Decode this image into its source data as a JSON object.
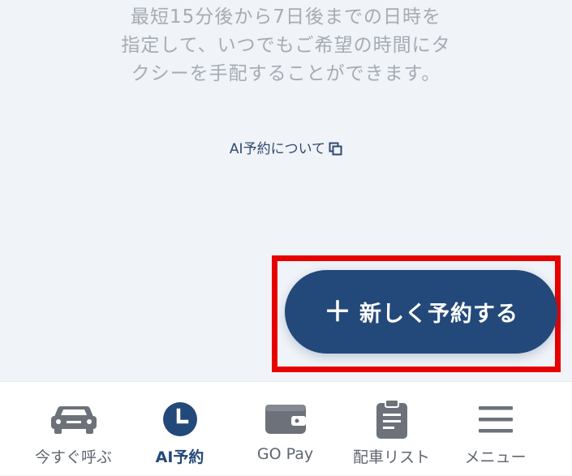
{
  "colors": {
    "background": "#f0f3f7",
    "accent": "#23497a",
    "highlight_border": "#e60000",
    "muted_text": "#a5acb5",
    "tab_icon": "#6d727a"
  },
  "description": {
    "lines": [
      "最短15分後から7日後までの日時を",
      "指定して、いつでもご希望の時間にタ",
      "クシーを手配することができます。"
    ]
  },
  "about_link": {
    "label": "AI予約について",
    "icon": "copy-icon"
  },
  "primary_action": {
    "plus": "＋",
    "label": "新しく予約する"
  },
  "tabbar": {
    "tabs": [
      {
        "label": "今すぐ呼ぶ",
        "icon": "car-icon",
        "active": false
      },
      {
        "label": "AI予約",
        "icon": "clock-icon",
        "active": true
      },
      {
        "label": "GO Pay",
        "icon": "wallet-icon",
        "active": false
      },
      {
        "label": "配車リスト",
        "icon": "clipboard-icon",
        "active": false
      },
      {
        "label": "メニュー",
        "icon": "menu-icon",
        "active": false
      }
    ]
  }
}
